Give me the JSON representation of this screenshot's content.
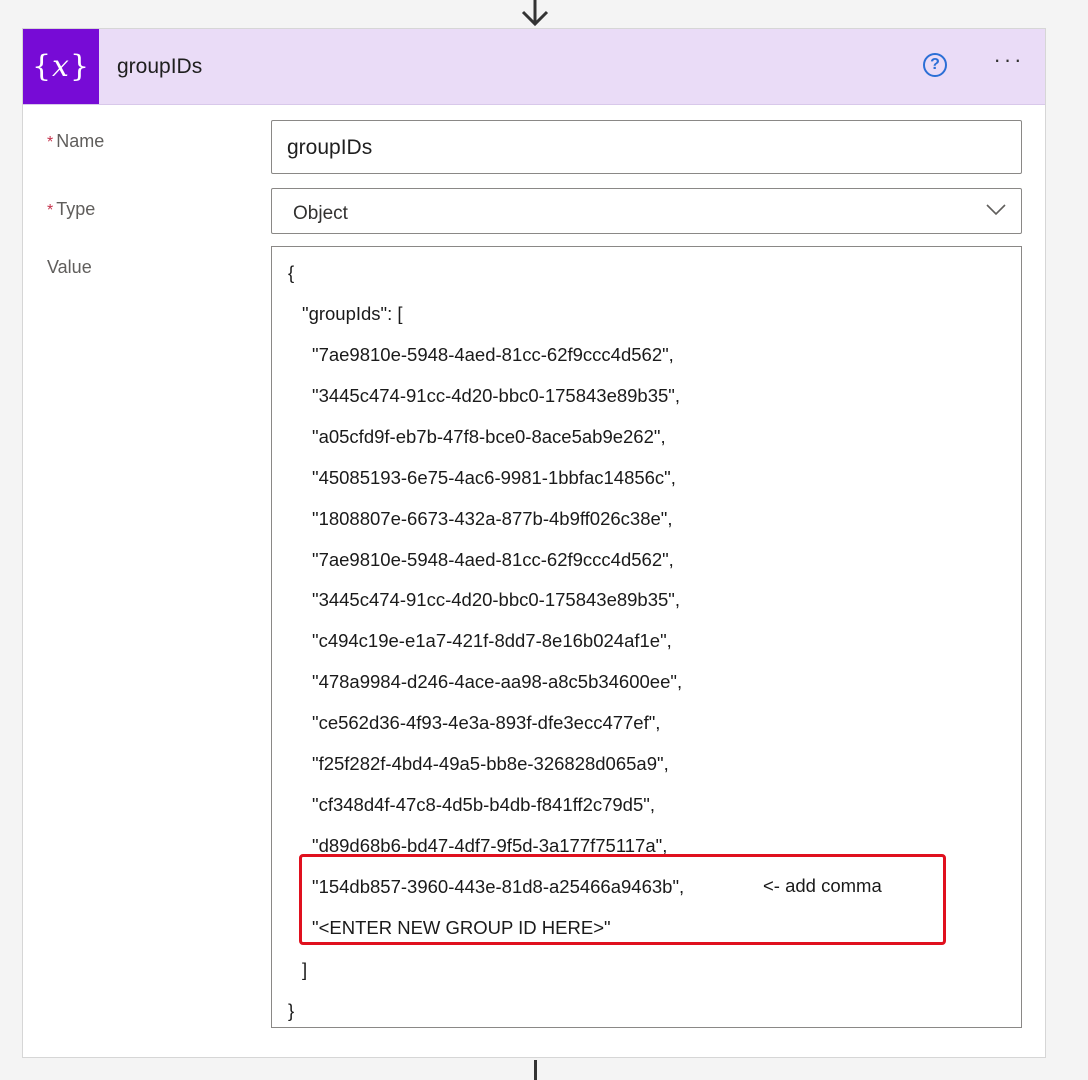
{
  "header": {
    "icon": "variable-braces-icon",
    "title": "groupIDs",
    "help_icon": "help-circle-icon",
    "more_icon": "more-ellipsis-icon",
    "accent_color": "#770bd6",
    "header_bg": "#eadcf7"
  },
  "form": {
    "required_marker": "*",
    "name_label": "Name",
    "name_value": "groupIDs",
    "type_label": "Type",
    "type_value": "Object",
    "value_label": "Value"
  },
  "value": {
    "open_brace": "{",
    "key_line": "\"groupIds\": [",
    "ids": [
      "\"7ae9810e-5948-4aed-81cc-62f9ccc4d562\",",
      "\"3445c474-91cc-4d20-bbc0-175843e89b35\",",
      "\"a05cfd9f-eb7b-47f8-bce0-8ace5ab9e262\",",
      "\"45085193-6e75-4ac6-9981-1bbfac14856c\",",
      "\"1808807e-6673-432a-877b-4b9ff026c38e\",",
      "\"7ae9810e-5948-4aed-81cc-62f9ccc4d562\",",
      "\"3445c474-91cc-4d20-bbc0-175843e89b35\",",
      "\"c494c19e-e1a7-421f-8dd7-8e16b024af1e\",",
      "\"478a9984-d246-4ace-aa98-a8c5b34600ee\",",
      "\"ce562d36-4f93-4e3a-893f-dfe3ecc477ef\",",
      "\"f25f282f-4bd4-49a5-bb8e-326828d065a9\",",
      "\"cf348d4f-47c8-4d5b-b4db-f841ff2c79d5\",",
      "\"d89d68b6-bd47-4df7-9f5d-3a177f75117a\",",
      "\"154db857-3960-443e-81d8-a25466a9463b\",",
      "\"<ENTER NEW GROUP ID HERE>\""
    ],
    "note": "<- add comma",
    "close_bracket": "]",
    "close_brace": "}",
    "highlight_color": "#e0101e"
  }
}
